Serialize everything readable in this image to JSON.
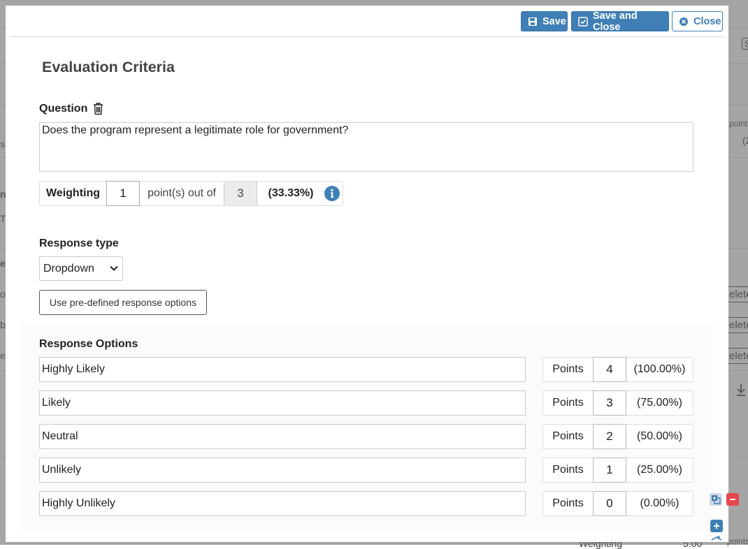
{
  "header": {
    "save_label": "Save",
    "save_close_label": "Save and Close",
    "close_label": "Close"
  },
  "page": {
    "title": "Evaluation Criteria"
  },
  "question": {
    "label": "Question",
    "text": "Does the program represent a legitimate role for government?"
  },
  "weighting": {
    "label": "Weighting",
    "value": "1",
    "out_of_label": "point(s) out of",
    "total": "3",
    "percent": "(33.33%)"
  },
  "response_type": {
    "label": "Response type",
    "selected": "Dropdown"
  },
  "predefined_button": "Use pre-defined response options",
  "response_options": {
    "label": "Response Options",
    "points_label": "Points",
    "items": [
      {
        "text": "Highly Likely",
        "points": "4",
        "percent": "(100.00%)"
      },
      {
        "text": "Likely",
        "points": "3",
        "percent": "(75.00%)"
      },
      {
        "text": "Neutral",
        "points": "2",
        "percent": "(50.00%)"
      },
      {
        "text": "Unlikely",
        "points": "1",
        "percent": "(25.00%)"
      },
      {
        "text": "Highly Unlikely",
        "points": "0",
        "percent": "(0.00%)"
      }
    ]
  },
  "background": {
    "frag_points": "pointi",
    "frag_paren": "(2",
    "frag_s": "s",
    "frag_ns": "ns",
    "frag_t": "T",
    "frag_e": "e",
    "frag_o": "o",
    "frag_be": "be",
    "frag_e2": "e",
    "delete_label": "elete",
    "weighting_label": "Weighting",
    "value_500": "5.00",
    "frag_points2": "points",
    "frag_box": "S"
  },
  "colors": {
    "primary": "#3f7fb6",
    "overlay": "#7a7a7a",
    "remove_tool": "#e8474f"
  }
}
